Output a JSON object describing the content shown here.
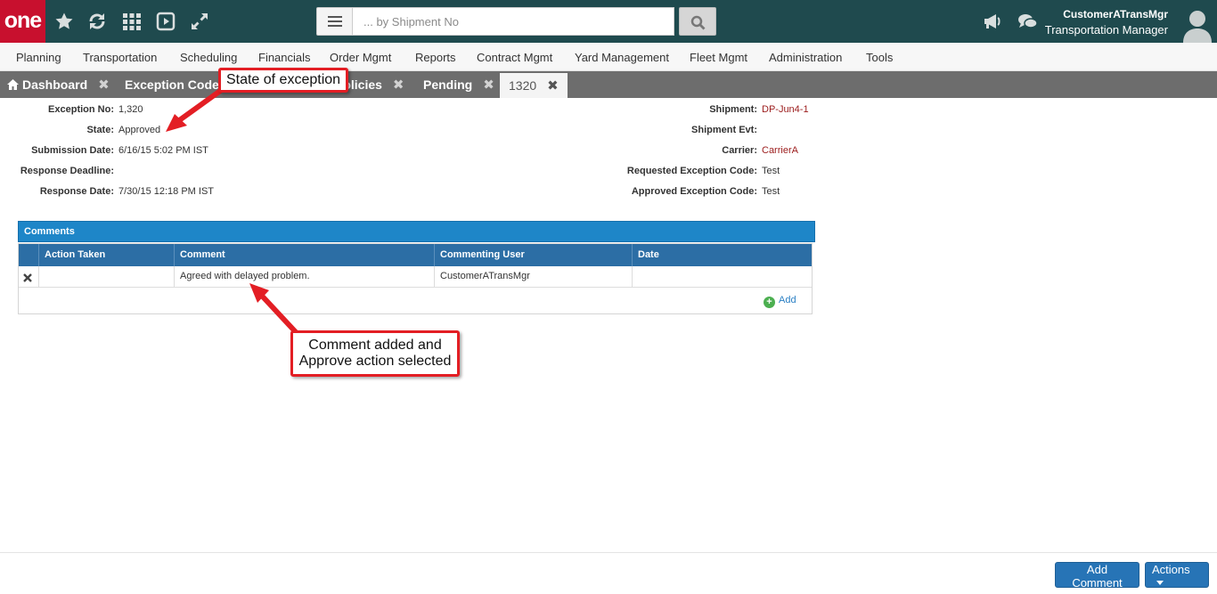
{
  "app": {
    "logo": "one",
    "search_placeholder": "... by Shipment No",
    "user_name": "CustomerATransMgr",
    "user_role": "Transportation Manager"
  },
  "menu": [
    "Planning",
    "Transportation",
    "Scheduling",
    "Financials",
    "Order Mgmt",
    "Reports",
    "Contract Mgmt",
    "Yard Management",
    "Fleet Mgmt",
    "Administration",
    "Tools"
  ],
  "tabs": [
    {
      "label": "Dashboard"
    },
    {
      "label": "Exception Codes"
    },
    {
      "label": "Policies"
    },
    {
      "label": "Pending"
    },
    {
      "label": "1320"
    }
  ],
  "details_left": [
    {
      "label": "Exception No:",
      "value": "1,320"
    },
    {
      "label": "State:",
      "value": "Approved"
    },
    {
      "label": "Submission Date:",
      "value": "6/16/15 5:02 PM IST"
    },
    {
      "label": "Response Deadline:",
      "value": ""
    },
    {
      "label": "Response Date:",
      "value": "7/30/15 12:18 PM IST"
    }
  ],
  "details_right": [
    {
      "label": "Shipment:",
      "value": "DP-Jun4-1"
    },
    {
      "label": "Shipment Evt:",
      "value": ""
    },
    {
      "label": "Carrier:",
      "value": "CarrierA"
    },
    {
      "label": "Requested Exception Code:",
      "value": "Test"
    },
    {
      "label": "Approved Exception Code:",
      "value": "Test"
    }
  ],
  "comments": {
    "title": "Comments",
    "columns": [
      "Action Taken",
      "Comment",
      "Commenting User",
      "Date"
    ],
    "rows": [
      {
        "action_taken": "",
        "comment": "Agreed with delayed problem.",
        "user": "CustomerATransMgr",
        "date": ""
      }
    ],
    "add_label": "Add"
  },
  "callouts": {
    "state": "State of exception",
    "comment_line1": "Comment added and",
    "comment_line2": "Approve action selected"
  },
  "footer": {
    "add_comment": "Add Comment",
    "actions": "Actions"
  },
  "icons": [
    "star-icon",
    "refresh-icon",
    "grid-icon",
    "play-icon",
    "expand-icon",
    "menu-icon",
    "search-icon",
    "megaphone-icon",
    "chat-icon",
    "user-avatar-icon",
    "home-icon",
    "close-icon",
    "caret-down-icon",
    "plus-circle-icon"
  ],
  "colors": {
    "header_bg": "#1f4a4e",
    "logo_bg": "#c8102e",
    "tabbar_bg": "#6d6d6d",
    "grid_title_bg": "#1e86c8",
    "grid_head_bg": "#2c6ea5",
    "primary_button": "#2774b6",
    "link_red": "#9b1b1b",
    "callout_border": "#e31e24"
  }
}
